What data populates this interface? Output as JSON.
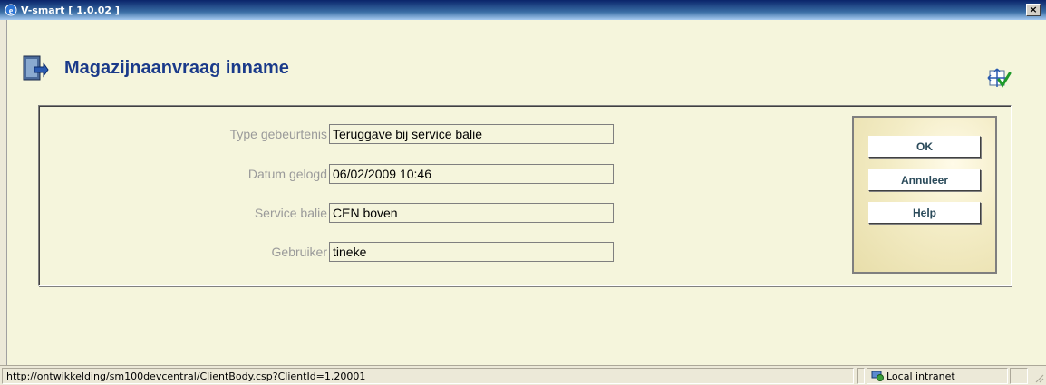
{
  "window": {
    "title": "V-smart [ 1.0.02 ]",
    "close_label": "×"
  },
  "page": {
    "title": "Magazijnaanvraag inname",
    "page_icon": "exit-door-icon",
    "corner_icon": "move-check-icon"
  },
  "form": {
    "fields": [
      {
        "label": "Type gebeurtenis",
        "value": "Teruggave bij service balie"
      },
      {
        "label": "Datum gelogd",
        "value": "06/02/2009 10:46"
      },
      {
        "label": "Service balie",
        "value": "CEN boven"
      },
      {
        "label": "Gebruiker",
        "value": "tineke"
      }
    ]
  },
  "buttons": {
    "ok": "OK",
    "cancel": "Annuleer",
    "help": "Help"
  },
  "statusbar": {
    "url": "http://ontwikkelding/sm100devcentral/ClientBody.csp?ClientId=1.20001",
    "zone": "Local intranet"
  },
  "colors": {
    "background": "#f5f5dc",
    "title": "#1a3a8a",
    "label": "#9a9a9a"
  }
}
